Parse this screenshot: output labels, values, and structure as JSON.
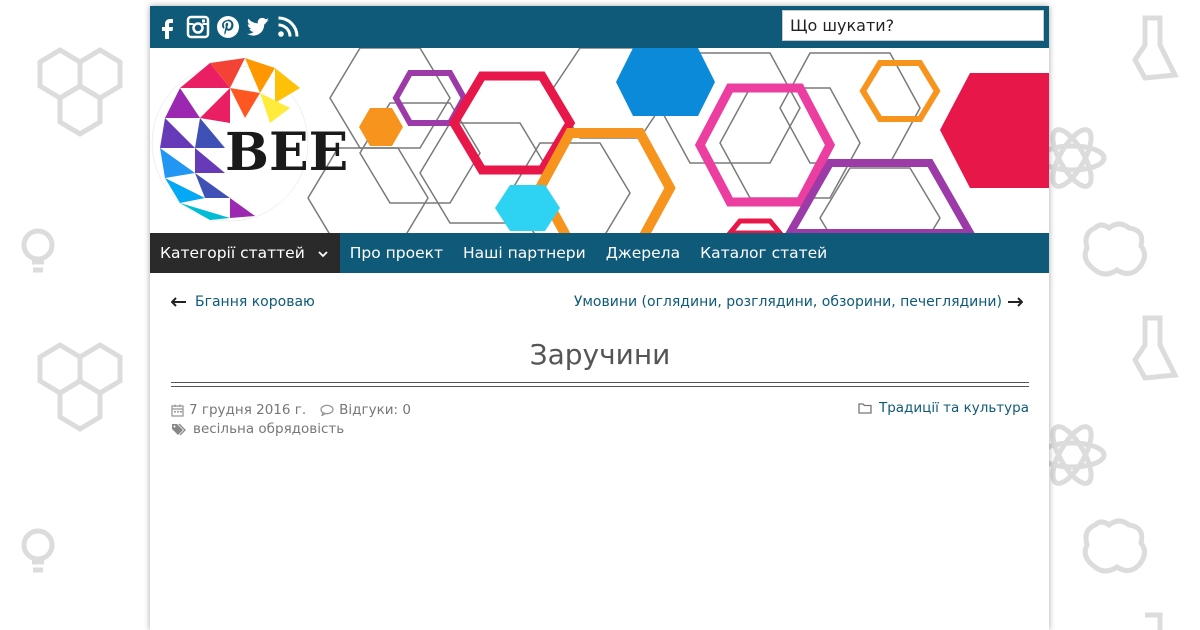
{
  "search": {
    "placeholder": "Що шукати?"
  },
  "social_icons": [
    "facebook-icon",
    "instagram-icon",
    "pinterest-icon",
    "twitter-icon",
    "rss-icon"
  ],
  "logo": {
    "text": "BEE"
  },
  "nav": {
    "items": [
      {
        "label": "Категорії статтей",
        "active": true,
        "has_dropdown": true
      },
      {
        "label": "Про проект"
      },
      {
        "label": "Наші партнери"
      },
      {
        "label": "Джерела"
      },
      {
        "label": "Каталог статей"
      }
    ]
  },
  "post_nav": {
    "prev": "Бгання короваю",
    "next": "Умовини (оглядини, розглядини, обзорини, печеглядини)"
  },
  "post": {
    "title": "Заручини",
    "date": "7 грудня 2016 г.",
    "comments": "Відгуки: 0",
    "category": "Традиції та культура",
    "tags": "весільна обрядовість"
  },
  "colors": {
    "topbar": "#0e5a78",
    "nav_active": "#2a2a2a",
    "link": "#0e5a78",
    "title": "#555555",
    "meta": "#777777"
  }
}
